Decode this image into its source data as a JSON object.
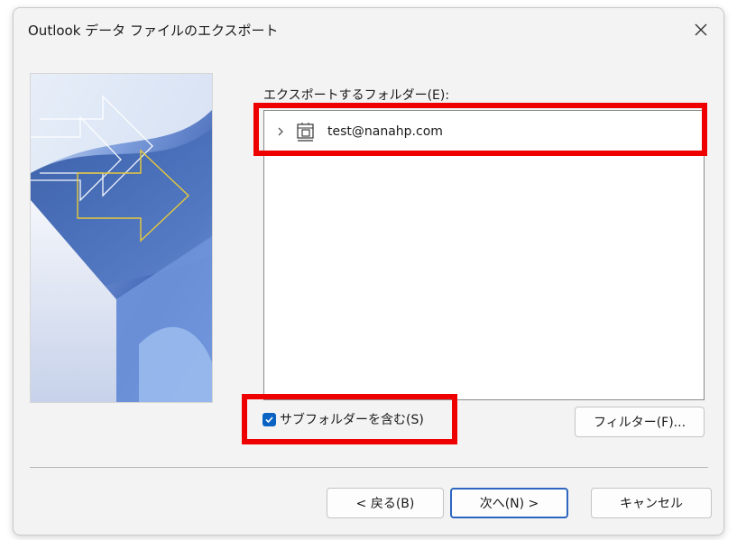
{
  "window": {
    "title": "Outlook データ ファイルのエクスポート",
    "close_icon": "close-icon"
  },
  "folder_section": {
    "label": "エクスポートするフォルダー(E):",
    "tree_items": [
      {
        "label": "test@nanahp.com",
        "icon": "account-icon",
        "expander": "chevron-right-icon",
        "expanded": false
      }
    ]
  },
  "options": {
    "include_subfolders_label": "サブフォルダーを含む(S)",
    "include_subfolders_checked": true
  },
  "buttons": {
    "filter": "フィルター(F)...",
    "back": "< 戻る(B)",
    "next": "次へ(N) >",
    "cancel": "キャンセル"
  },
  "colors": {
    "accent": "#0a63c2",
    "highlight": "#ee0000",
    "dialog_bg": "#f3f3f3"
  }
}
